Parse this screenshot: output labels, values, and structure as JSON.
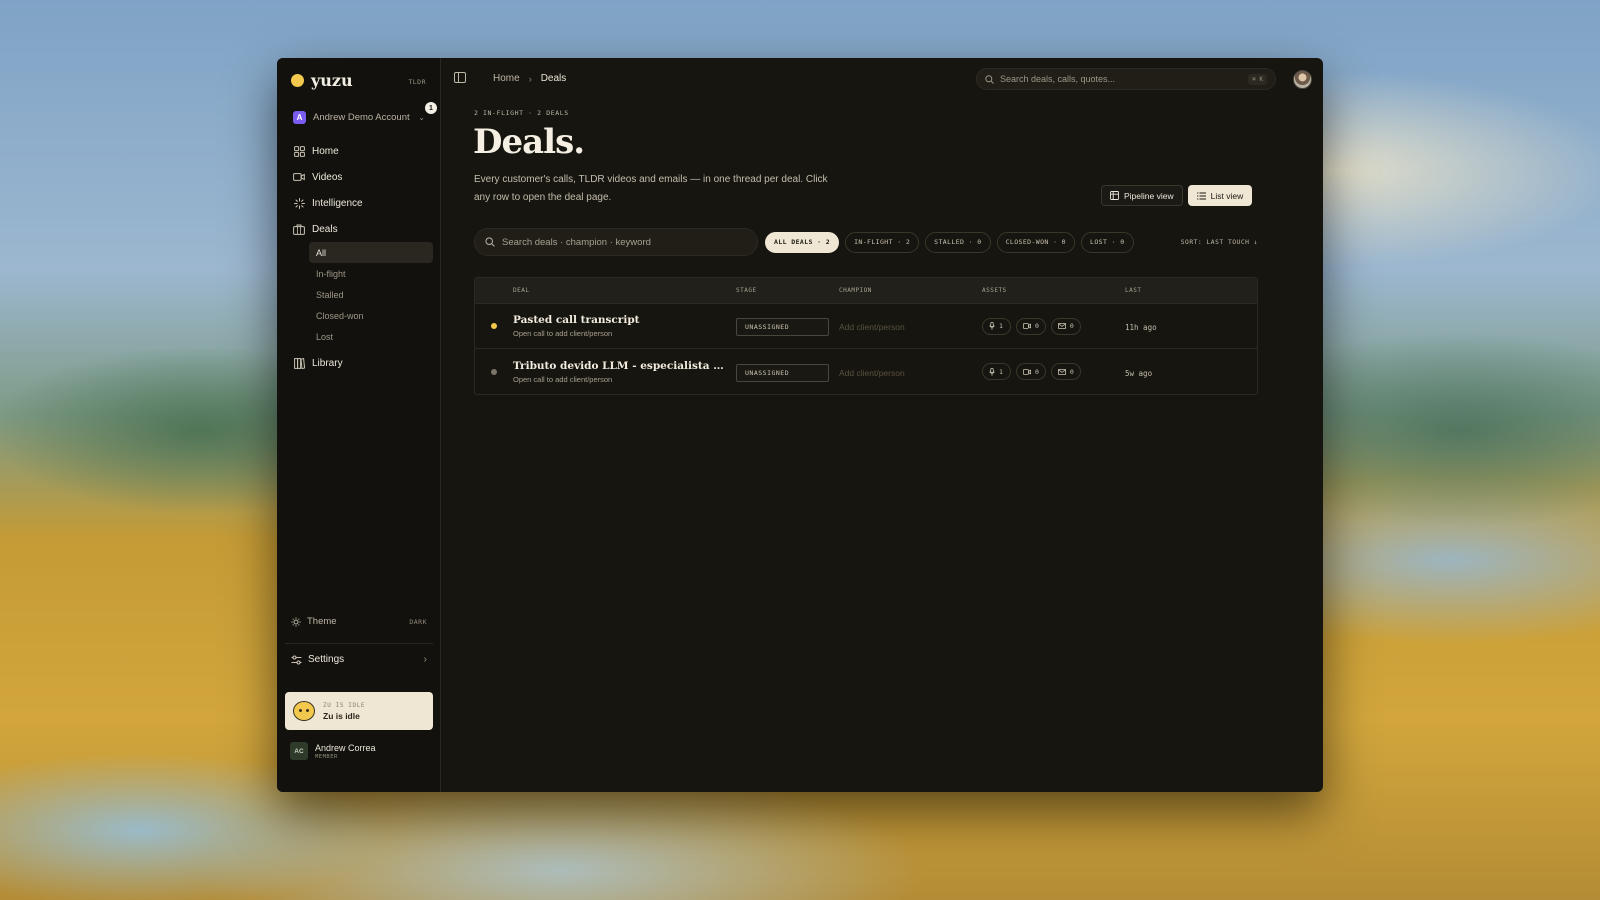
{
  "brand": {
    "name": "yuzu",
    "tag": "TLDR"
  },
  "account": {
    "name": "Andrew Demo Account",
    "initial": "A",
    "notification_count": "1"
  },
  "sidebar": {
    "items": [
      {
        "label": "Home",
        "icon": "home-grid-icon"
      },
      {
        "label": "Videos",
        "icon": "video-icon"
      },
      {
        "label": "Intelligence",
        "icon": "sparkle-icon"
      },
      {
        "label": "Deals",
        "icon": "briefcase-icon"
      }
    ],
    "deals_subitems": [
      {
        "label": "All",
        "active": true
      },
      {
        "label": "In-flight",
        "active": false
      },
      {
        "label": "Stalled",
        "active": false
      },
      {
        "label": "Closed-won",
        "active": false
      },
      {
        "label": "Lost",
        "active": false
      }
    ],
    "library_label": "Library",
    "theme_label": "Theme",
    "theme_value": "DARK",
    "settings_label": "Settings",
    "idle": {
      "kicker": "ZU IS IDLE",
      "text": "Zu is idle"
    },
    "user": {
      "initials": "AC",
      "name": "Andrew Correa",
      "role": "MEMBER"
    }
  },
  "topbar": {
    "breadcrumb": [
      "Home",
      "Deals"
    ],
    "search_placeholder": "Search deals, calls, quotes...",
    "search_shortcut": "⌘ K"
  },
  "page": {
    "kicker": "2 IN-FLIGHT · 2 DEALS",
    "title": "Deals.",
    "description": "Every customer's calls, TLDR videos and emails — in one thread per deal. Click any row to open the deal page.",
    "pipeline_view_label": "Pipeline view",
    "list_view_label": "List view"
  },
  "filters": {
    "search_placeholder": "Search deals · champion · keyword",
    "chips": [
      {
        "label": "ALL DEALS · 2",
        "active": true
      },
      {
        "label": "IN-FLIGHT · 2",
        "active": false
      },
      {
        "label": "STALLED · 0",
        "active": false
      },
      {
        "label": "CLOSED-WON · 0",
        "active": false
      },
      {
        "label": "LOST · 0",
        "active": false
      }
    ],
    "sort_label": "SORT: LAST TOUCH ↓"
  },
  "table": {
    "columns": [
      "DEAL",
      "STAGE",
      "CHAMPION",
      "ASSETS",
      "LAST"
    ],
    "rows": [
      {
        "status_color": "#f2c94c",
        "title": "Pasted call transcript",
        "subtitle": "Open call to add client/person",
        "stage": "UNASSIGNED",
        "champion": "Add client/person",
        "assets": {
          "calls": "1",
          "videos": "0",
          "emails": "0"
        },
        "last": "11h ago"
      },
      {
        "status_color": "#7a7568",
        "title": "Tributo devido LLM - especialista deci...",
        "subtitle": "Open call to add client/person",
        "stage": "UNASSIGNED",
        "champion": "Add client/person",
        "assets": {
          "calls": "1",
          "videos": "0",
          "emails": "0"
        },
        "last": "5w ago"
      }
    ]
  }
}
